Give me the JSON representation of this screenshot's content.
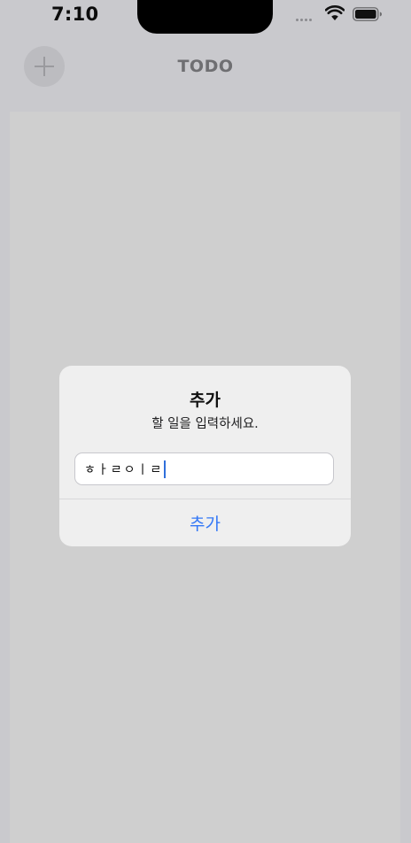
{
  "status_bar": {
    "time": "7:10",
    "wifi_icon": "wifi-icon",
    "battery_icon": "battery-icon"
  },
  "nav": {
    "title": "TODO",
    "add_icon": "plus-icon"
  },
  "dialog": {
    "title": "추가",
    "message": "할 일을 입력하세요.",
    "input_value": "ㅎㅏㄹㅇㅣㄹ",
    "confirm_label": "추가"
  },
  "colors": {
    "accent": "#3478f6",
    "cursor": "#2f6fdb"
  }
}
